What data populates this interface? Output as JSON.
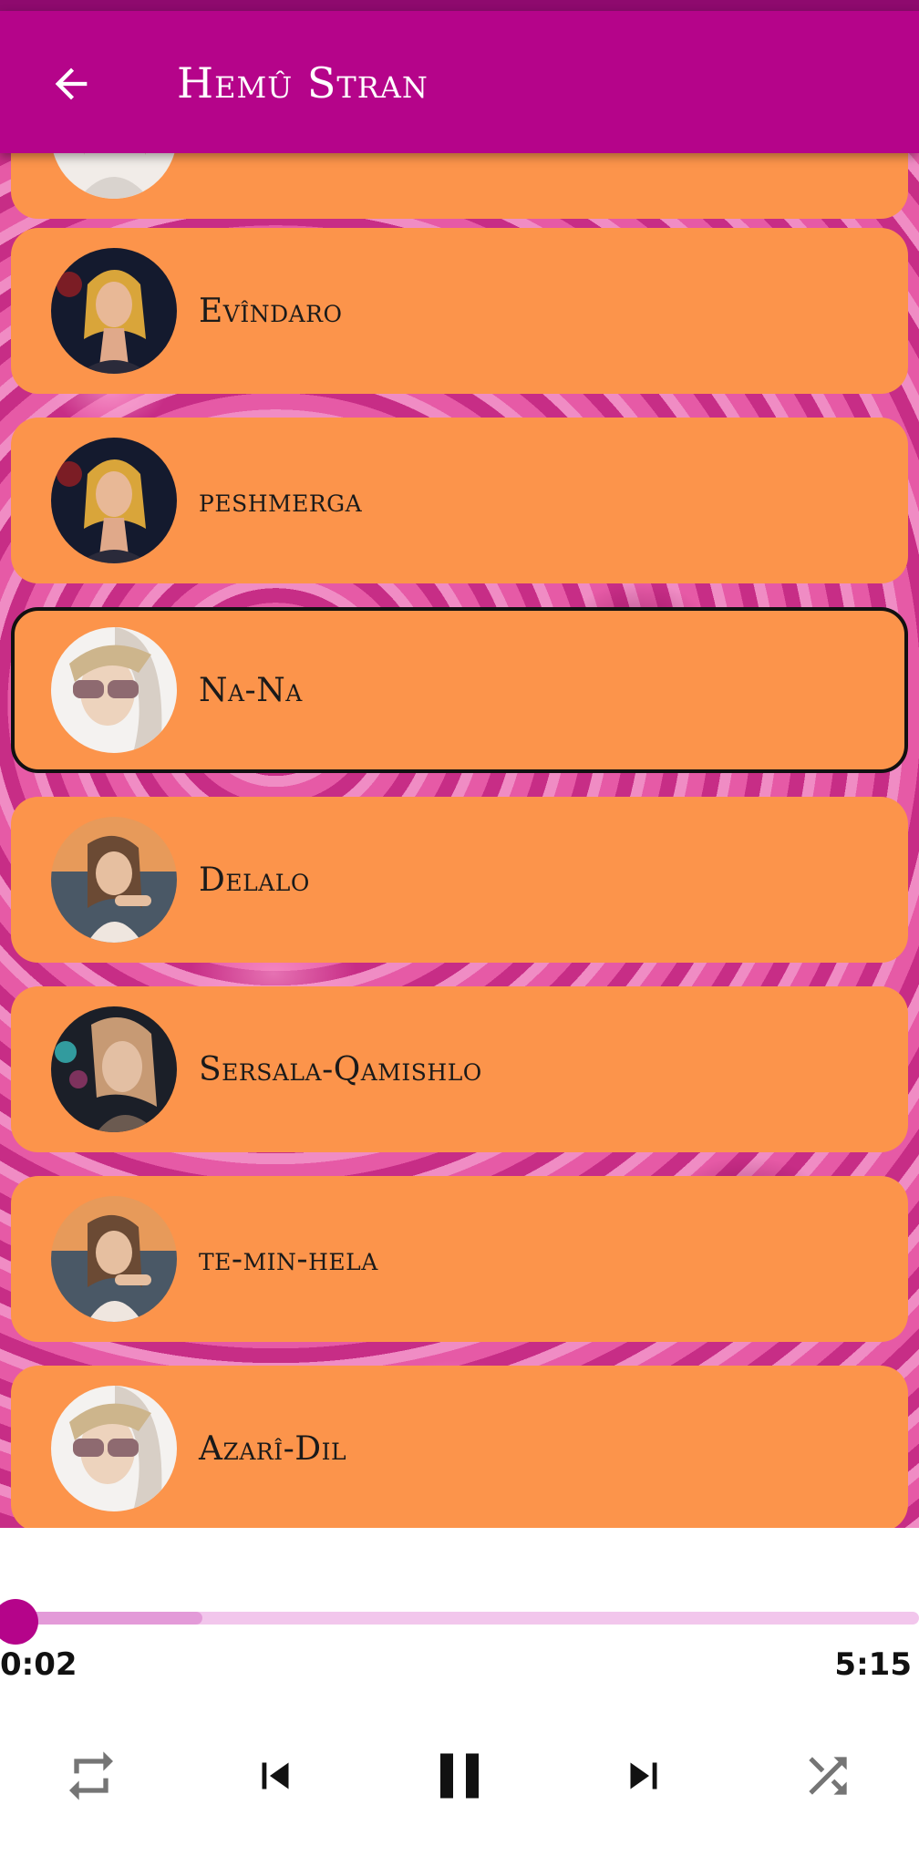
{
  "app": {
    "title": "Hemû Stran"
  },
  "songs": [
    {
      "title": "Evîndaro",
      "active": false
    },
    {
      "title": "peshmerga",
      "active": false
    },
    {
      "title": "Na-Na",
      "active": true
    },
    {
      "title": "Delalo",
      "active": false
    },
    {
      "title": "Sersala-Qamishlo",
      "active": false
    },
    {
      "title": "te-min-hela",
      "active": false
    },
    {
      "title": "Azarî-Dil",
      "active": false
    }
  ],
  "player": {
    "elapsed": "0:02",
    "duration": "5:15",
    "progress_fraction": 0.006,
    "buffered_fraction": 0.22
  },
  "icons": {
    "back": "arrow-left-icon",
    "repeat": "repeat-icon",
    "previous": "skip-previous-icon",
    "pause": "pause-icon",
    "next": "skip-next-icon",
    "shuffle": "shuffle-icon"
  },
  "colors": {
    "app_bar": "#b5048a",
    "card": "#fc944b",
    "accent": "#b5048a"
  }
}
